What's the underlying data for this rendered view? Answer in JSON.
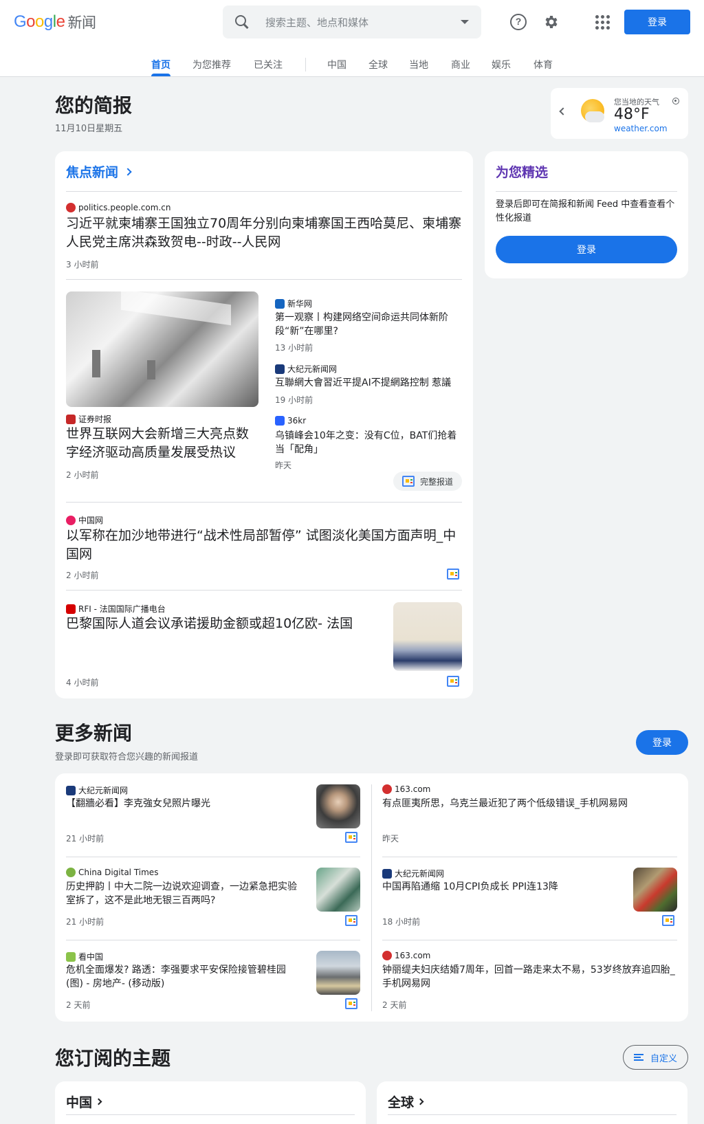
{
  "header": {
    "logo_google": [
      "G",
      "o",
      "o",
      "g",
      "l",
      "e"
    ],
    "logo_colors": [
      "#4285f4",
      "#ea4335",
      "#fbbc04",
      "#4285f4",
      "#34a853",
      "#ea4335"
    ],
    "logo_news": "新闻",
    "search_placeholder": "搜索主题、地点和媒体",
    "help_glyph": "?",
    "login": "登录",
    "icons": [
      "search-icon",
      "chevron-down-icon",
      "help-icon",
      "gear-icon",
      "apps-icon"
    ]
  },
  "tabs": [
    {
      "label": "首页",
      "active": true
    },
    {
      "label": "为您推荐"
    },
    {
      "label": "已关注"
    },
    {
      "label": "中国"
    },
    {
      "label": "全球"
    },
    {
      "label": "当地"
    },
    {
      "label": "商业"
    },
    {
      "label": "娱乐"
    },
    {
      "label": "体育"
    }
  ],
  "briefing": {
    "title": "您的简报",
    "date": "11月10日星期五"
  },
  "weather": {
    "label": "您当地的天气",
    "temp": "48°F",
    "source": "weather.com"
  },
  "headlines": {
    "section": "焦点新闻",
    "full_coverage": "完整报道",
    "stories": [
      {
        "source": "politics.people.com.cn",
        "fav_color": "#d32f2f",
        "title": "习近平就柬埔寨王国独立70周年分别向柬埔寨国王西哈莫尼、柬埔寨人民党主席洪森致贺电--时政--人民网",
        "time": "3 小时前"
      },
      {
        "source": "证券时报",
        "fav_color": "#c62828",
        "title": "世界互联网大会新增三大亮点数字经济驱动高质量发展受热议",
        "time": "2 小时前"
      },
      {
        "source": "新华网",
        "fav_color": "#1565c0",
        "title": "第一观察丨构建网络空间命运共同体新阶段“新”在哪里?",
        "time": "13 小时前"
      },
      {
        "source": "大纪元新闻网",
        "fav_color": "#1a3a7a",
        "title": "互聯網大會習近平提AI不提網路控制 惹議",
        "time": "19 小时前"
      },
      {
        "source": "36kr",
        "fav_color": "#2962ff",
        "title": "乌镇峰会10年之变：没有C位，BAT们抢着当「配角」",
        "time": "昨天"
      },
      {
        "source": "中国网",
        "fav_color": "#e91e63",
        "title": "以军称在加沙地带进行“战术性局部暂停” 试图淡化美国方面声明_中国网",
        "time": "2 小时前"
      },
      {
        "source": "RFI - 法国国际广播电台",
        "fav_color": "#d50000",
        "title": "巴黎国际人道会议承诺援助金额或超10亿欧- 法国",
        "time": "4 小时前"
      }
    ]
  },
  "picks": {
    "title": "为您精选",
    "text": "登录后即可在简报和新闻 Feed 中查看查看个性化报道",
    "button": "登录"
  },
  "more": {
    "title": "更多新闻",
    "subtitle": "登录即可获取符合您兴趣的新闻报道",
    "login": "登录",
    "left": [
      {
        "source": "大纪元新闻网",
        "fav_color": "#1a3a7a",
        "title": "【翻牆必看】李克強女兒照片曝光",
        "time": "21 小时前"
      },
      {
        "source": "China Digital Times",
        "fav_color": "#7cb342",
        "title": "历史押韵丨中大二院一边说欢迎调查，一边紧急把实验室拆了，这不是此地无银三百两吗?",
        "time": "21 小时前"
      },
      {
        "source": "看中国",
        "fav_color": "#8bc34a",
        "title": "危机全面爆发? 路透：李强要求平安保险接管碧桂园(图) - 房地产- (移动版)",
        "time": "2 天前"
      }
    ],
    "right": [
      {
        "source": "163.com",
        "fav_color": "#d32f2f",
        "title": "有点匪夷所思，乌克兰最近犯了两个低级错误_手机网易网",
        "time": "昨天"
      },
      {
        "source": "大纪元新闻网",
        "fav_color": "#1a3a7a",
        "title": "中国再陷通缩 10月CPI负成长 PPI连13降",
        "time": "18 小时前"
      },
      {
        "source": "163.com",
        "fav_color": "#d32f2f",
        "title": "钟丽缇夫妇庆结婚7周年，回首一路走来太不易，53岁终放弃追四胎_手机网易网",
        "time": "2 天前"
      }
    ]
  },
  "topics": {
    "title": "您订阅的主题",
    "customize": "自定义",
    "items": [
      "中国",
      "全球"
    ]
  }
}
